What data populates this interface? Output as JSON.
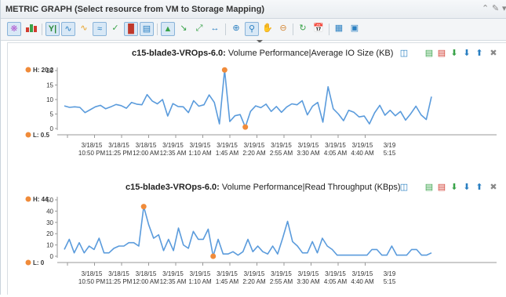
{
  "header": {
    "title": "METRIC GRAPH (Select resource from VM to Storage Mapping)"
  },
  "toolbar": {
    "icons": [
      "metric-picker-icon",
      "dashboard-icon",
      "y-axis-icon",
      "sparkline-icon",
      "trend-icon",
      "stack-icon",
      "combine-icon",
      "split-icon",
      "compare-icon",
      "baseline-icon",
      "refresh-range-icon",
      "zoom-all-icon",
      "fit-icon",
      "zoom-in-icon",
      "zoom-view-icon",
      "pan-icon",
      "zoom-out-icon",
      "refresh-icon",
      "date-range-icon",
      "calendar-icon",
      "snapshot-icon"
    ]
  },
  "chart_data": [
    {
      "type": "line",
      "title_resource": "c15-blade3-VROps-6.0:",
      "title_metric": "Volume Performance|Average IO Size (KB)",
      "high_label": "H: 20.2",
      "low_label": "L: 0.5",
      "ylim": [
        0,
        20
      ],
      "yticks": [
        0,
        5,
        10,
        15,
        20
      ],
      "grid": false,
      "color": "#5a9bdc",
      "marker_color": "#f08b3a",
      "xlabels": [
        [
          "3/18/15",
          "10:50 PM"
        ],
        [
          "3/18/15",
          "11:25 PM"
        ],
        [
          "3/18/15",
          "12:00 AM"
        ],
        [
          "3/19/15",
          "12:35 AM"
        ],
        [
          "3/19/15",
          "1:10 AM"
        ],
        [
          "3/19/15",
          "1:45 AM"
        ],
        [
          "3/19/15",
          "2:20 AM"
        ],
        [
          "3/19/15",
          "2:55 AM"
        ],
        [
          "3/19/15",
          "3:30 AM"
        ],
        [
          "3/19/15",
          "4:05 AM"
        ],
        [
          "3/19/15",
          "4:40 AM"
        ],
        [
          "3/19",
          "5:15"
        ]
      ],
      "values": [
        7.8,
        7.3,
        7.5,
        7.3,
        5.5,
        6.5,
        7.5,
        8,
        6.8,
        7.5,
        8.3,
        7.9,
        7,
        9,
        8.4,
        8.2,
        11.7,
        9.5,
        8.5,
        10,
        4.3,
        8.6,
        7.6,
        7.5,
        5.5,
        9.6,
        7.7,
        8.2,
        11.6,
        9,
        1.6,
        20.2,
        2.4,
        4.4,
        4.8,
        0.5,
        5.9,
        7.8,
        7.2,
        8.4,
        5.9,
        7.6,
        5.6,
        7.4,
        8.5,
        8.2,
        9.6,
        4.7,
        7.7,
        9,
        2.2,
        14.4,
        6.8,
        5,
        2.7,
        6.3,
        5.6,
        4,
        4.3,
        1.6,
        5.4,
        8,
        4.6,
        6.3,
        4.4,
        5.9,
        2.9,
        5.1,
        7.7,
        4.7,
        3.1,
        11
      ]
    },
    {
      "type": "line",
      "title_resource": "c15-blade3-VROps-6.0:",
      "title_metric": "Volume Performance|Read Throughput (KBps)",
      "high_label": "H: 44",
      "low_label": "L: 0",
      "ylim": [
        0,
        50
      ],
      "yticks": [
        0,
        10,
        20,
        30,
        40,
        50
      ],
      "grid": false,
      "color": "#5a9bdc",
      "marker_color": "#f08b3a",
      "xlabels": [
        [
          "3/18/15",
          "10:50 PM"
        ],
        [
          "3/18/15",
          "11:25 PM"
        ],
        [
          "3/18/15",
          "12:00 AM"
        ],
        [
          "3/19/15",
          "12:35 AM"
        ],
        [
          "3/19/15",
          "1:10 AM"
        ],
        [
          "3/19/15",
          "1:45 AM"
        ],
        [
          "3/19/15",
          "2:20 AM"
        ],
        [
          "3/19/15",
          "2:55 AM"
        ],
        [
          "3/19/15",
          "3:30 AM"
        ],
        [
          "3/19/15",
          "4:05 AM"
        ],
        [
          "3/19/15",
          "4:40 AM"
        ],
        [
          "3/19",
          "5:15"
        ]
      ],
      "values": [
        6,
        15,
        3,
        12,
        3,
        9,
        6,
        16,
        3,
        3,
        7,
        9,
        9,
        12,
        12,
        9,
        44,
        28,
        16,
        19,
        5,
        15,
        5,
        25,
        10,
        7,
        22,
        15,
        15,
        24,
        0,
        15,
        2,
        2,
        4,
        1,
        4,
        15,
        4,
        9,
        4,
        2,
        9,
        2,
        16,
        31,
        13,
        9,
        3,
        3,
        13,
        3,
        16,
        9,
        6,
        1,
        1,
        1,
        1,
        1,
        1,
        1,
        6,
        6,
        1,
        1,
        9,
        1,
        1,
        1,
        6,
        6,
        1,
        1,
        3
      ]
    }
  ],
  "charts_ui": {
    "actions": [
      "metric-chooser-icon",
      "save-icon",
      "save-all-icon",
      "move-down-icon",
      "move-down-icon",
      "move-up-icon",
      "close-icon"
    ]
  }
}
